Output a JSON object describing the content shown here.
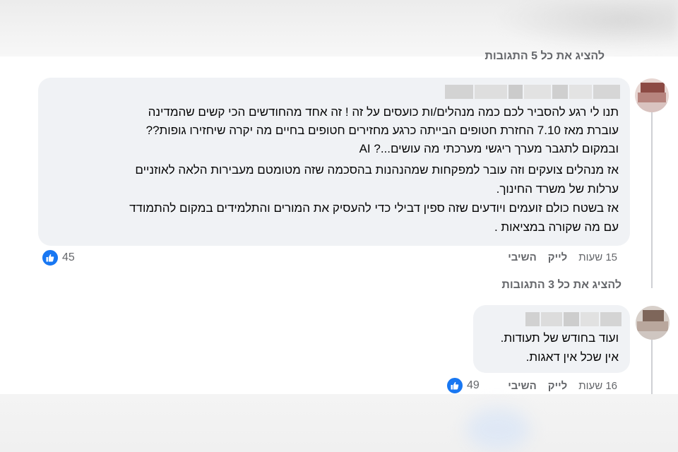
{
  "thread": {
    "view_all_5": "להציג את כל 5 התגובות",
    "view_all_3": "להציג את כל 3 התגובות"
  },
  "comments": [
    {
      "lines": [
        "תנו לי רגע להסביר לכם כמה מנהלים/ות כועסים על זה ! זה אחד מהחודשים הכי קשים שהמדינה",
        "עוברת מאז 7.10 החזרת חטופים הבייתה כרגע מחזירים חטופים בחיים מה יקרה שיחזירו גופות??",
        "ובמקום לתגבר מערך ריגשי מערכתי מה עושים...? AI",
        "אז מנהלים צועקים וזה עובר למפקחות שמהנהנות בהסכמה שזה מטומטם מעבירות הלאה לאוזניים",
        "ערלות של משרד החינוך.",
        "אז בשטח כולם זועמים ויודעים שזה ספין דבילי כדי להעסיק את המורים והתלמידים במקום להתמודד",
        "עם מה שקורה במציאות ."
      ],
      "time": "15 שעות",
      "like": "לייק",
      "reply": "השיבי",
      "reactions": "45",
      "reaction_icon": "like-thumb-icon"
    },
    {
      "lines": [
        "ועוד בחודש של תעודות.",
        "אין שכל אין דאגות."
      ],
      "time": "16 שעות",
      "like": "לייק",
      "reply": "השיבי",
      "reactions": "49",
      "reaction_icon": "like-thumb-icon"
    }
  ],
  "colors": {
    "bubble": "#f0f2f5",
    "meta_text": "#65676b",
    "like_blue": "#1877f2",
    "thread_line": "#ced0d4"
  }
}
